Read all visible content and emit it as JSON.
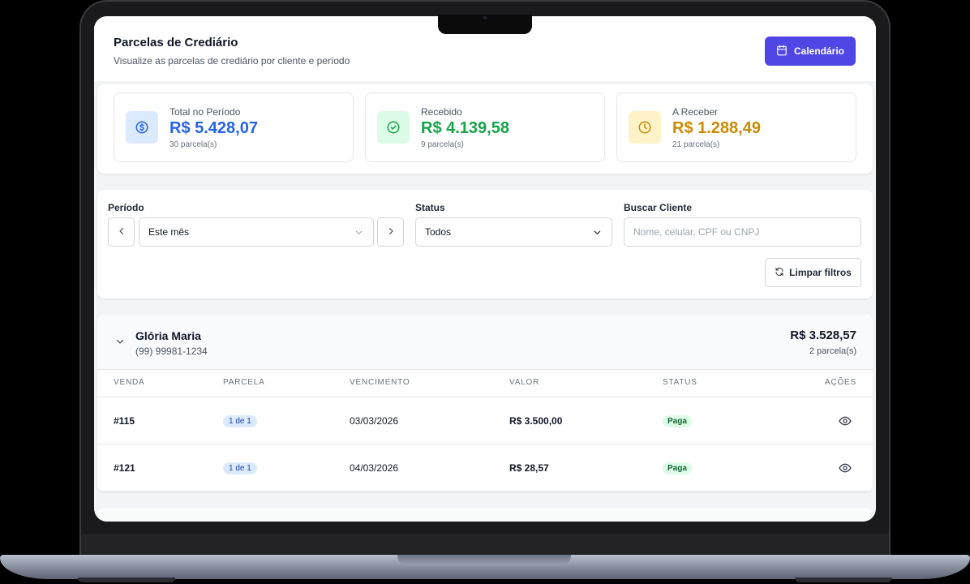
{
  "header": {
    "title": "Parcelas de Crediário",
    "subtitle": "Visualize as parcelas de crediário por cliente e período",
    "calendar_button": "Calendário"
  },
  "summary": [
    {
      "label": "Total no Período",
      "value": "R$ 5.428,07",
      "sub": "30 parcela(s)",
      "icon": "dollar-icon",
      "color": "#2563eb",
      "bg": "#dbeafe"
    },
    {
      "label": "Recebido",
      "value": "R$ 4.139,58",
      "sub": "9 parcela(s)",
      "icon": "check-circle-icon",
      "color": "#16a34a",
      "bg": "#dcfce7"
    },
    {
      "label": "A Receber",
      "value": "R$ 1.288,49",
      "sub": "21 parcela(s)",
      "icon": "clock-icon",
      "color": "#ca8a04",
      "bg": "#fef3c7"
    }
  ],
  "filters": {
    "period_label": "Período",
    "period_value": "Este mês",
    "status_label": "Status",
    "status_value": "Todos",
    "search_label": "Buscar Cliente",
    "search_placeholder": "Nome, celular, CPF ou CNPJ",
    "clear_button": "Limpar filtros"
  },
  "group": {
    "client_name": "Glória Maria",
    "client_phone": "(99) 99981-1234",
    "total": "R$ 3.528,57",
    "count": "2 parcela(s)",
    "columns": [
      "VENDA",
      "PARCELA",
      "VENCIMENTO",
      "VALOR",
      "STATUS",
      "AÇÕES"
    ],
    "rows": [
      {
        "venda": "#115",
        "parcela": "1 de 1",
        "vencimento": "03/03/2026",
        "valor": "R$ 3.500,00",
        "status": "Paga"
      },
      {
        "venda": "#121",
        "parcela": "1 de 1",
        "vencimento": "04/03/2026",
        "valor": "R$ 28,57",
        "status": "Paga"
      }
    ]
  },
  "colors": {
    "accent": "#4f46e5",
    "paid": "#166534"
  }
}
